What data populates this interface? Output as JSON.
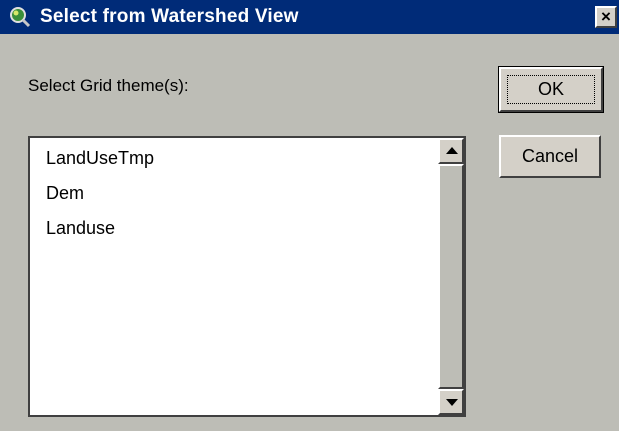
{
  "window": {
    "title": "Select from Watershed View",
    "close_label": "×",
    "icon": "magnifier-globe-icon"
  },
  "prompt_label": "Select Grid theme(s):",
  "list": {
    "items": [
      "LandUseTmp",
      "Dem",
      "Landuse"
    ]
  },
  "buttons": {
    "ok_label": "OK",
    "cancel_label": "Cancel"
  },
  "colors": {
    "titlebar": "#002b78",
    "dialog_bg": "#bdbdb6"
  }
}
